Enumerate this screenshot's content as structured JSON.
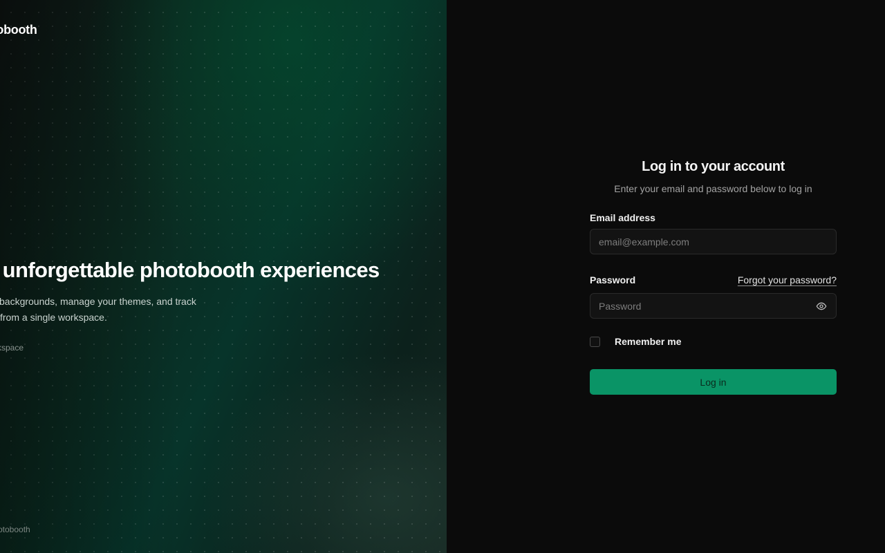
{
  "left_panel": {
    "brand_text": "otobooth",
    "headline": "e unforgettable photobooth experiences",
    "tagline_line1": "backgrounds, manage your themes, and track",
    "tagline_line2": "from a single workspace.",
    "workspace_link": "kspace",
    "footer_note": "otobooth"
  },
  "login_form": {
    "title": "Log in to your account",
    "subtitle": "Enter your email and password below to log in",
    "email": {
      "label": "Email address",
      "placeholder": "email@example.com",
      "value": ""
    },
    "password": {
      "label": "Password",
      "placeholder": "Password",
      "value": "",
      "toggle_icon": "eye-icon"
    },
    "forgot_link": "Forgot your password?",
    "remember_label": "Remember me",
    "remember_checked": false,
    "submit_label": "Log in"
  },
  "colors": {
    "accent": "#0a9466",
    "left_bg": "#07342a",
    "right_bg": "#0b0b0b"
  }
}
